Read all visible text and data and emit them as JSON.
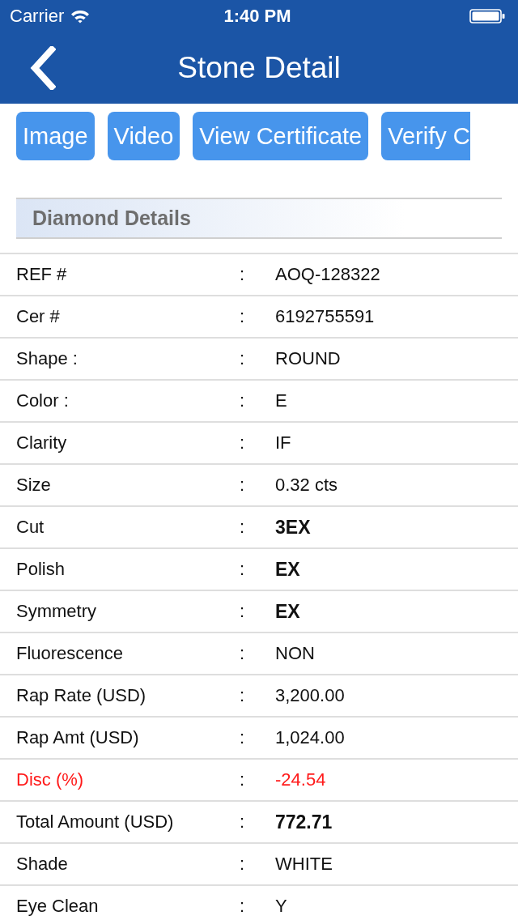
{
  "status_bar": {
    "carrier": "Carrier",
    "time": "1:40 PM"
  },
  "nav_bar": {
    "title": "Stone Detail"
  },
  "actions": [
    {
      "label": "Image"
    },
    {
      "label": "Video"
    },
    {
      "label": "View Certificate"
    },
    {
      "label": "Verify C"
    }
  ],
  "section": {
    "title": "Diamond Details"
  },
  "details": [
    {
      "label": "REF #",
      "separator": ":",
      "value": "AOQ-128322",
      "kind": "plain"
    },
    {
      "label": "Cer #",
      "separator": ":",
      "value": "6192755591",
      "kind": "plain"
    },
    {
      "label": "Shape :",
      "separator": ":",
      "value": "ROUND",
      "kind": "plain"
    },
    {
      "label": "Color :",
      "separator": ":",
      "value": "E",
      "kind": "plain"
    },
    {
      "label": "Clarity",
      "separator": ":",
      "value": "IF",
      "kind": "plain"
    },
    {
      "label": "Size",
      "separator": ":",
      "value": "0.32 cts",
      "kind": "plain"
    },
    {
      "label": "Cut",
      "separator": ":",
      "value": "3EX",
      "kind": "bold"
    },
    {
      "label": "Polish",
      "separator": ":",
      "value": "EX",
      "kind": "bold"
    },
    {
      "label": "Symmetry",
      "separator": ":",
      "value": "EX",
      "kind": "bold"
    },
    {
      "label": "Fluorescence",
      "separator": ":",
      "value": "NON",
      "kind": "plain"
    },
    {
      "label": "Rap Rate (USD)",
      "separator": ":",
      "value": "3,200.00",
      "kind": "plain"
    },
    {
      "label": "Rap Amt (USD)",
      "separator": ":",
      "value": "1,024.00",
      "kind": "plain"
    },
    {
      "label": "Disc (%)",
      "separator": ":",
      "value": "-24.54",
      "kind": "alert"
    },
    {
      "label": "Total Amount (USD)",
      "separator": ":",
      "value": "772.71",
      "kind": "bold"
    },
    {
      "label": "Shade",
      "separator": ":",
      "value": "WHITE",
      "kind": "plain"
    },
    {
      "label": "Eye Clean",
      "separator": ":",
      "value": "Y",
      "kind": "plain"
    }
  ]
}
